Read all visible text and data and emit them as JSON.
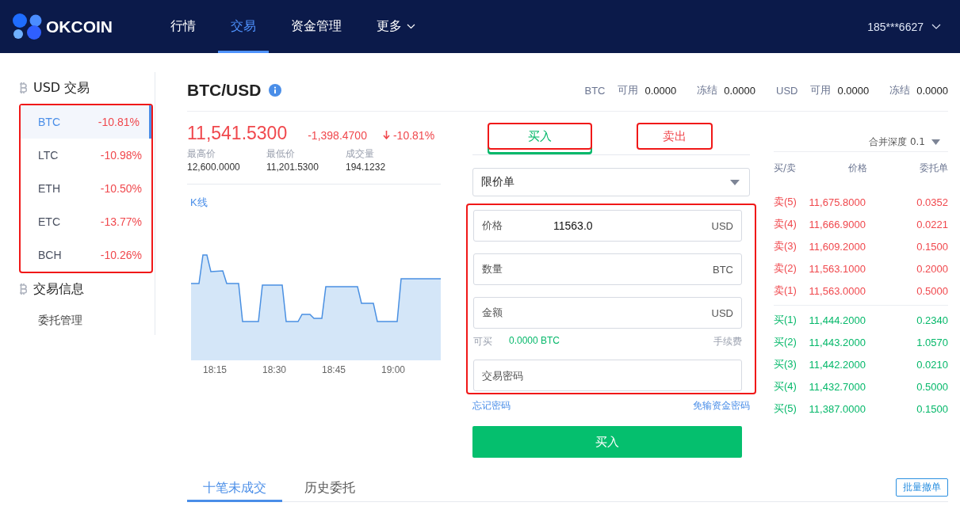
{
  "nav": {
    "logo": "OKCOIN",
    "items": [
      {
        "label": "行情",
        "selected": false,
        "dropdown": false
      },
      {
        "label": "交易",
        "selected": true,
        "dropdown": false
      },
      {
        "label": "资金管理",
        "selected": false,
        "dropdown": false
      },
      {
        "label": "更多",
        "selected": false,
        "dropdown": true
      }
    ],
    "user": "185***6627"
  },
  "sidebar": {
    "markets": {
      "title": "USD 交易",
      "items": [
        {
          "symbol": "BTC",
          "change": "-10.81%",
          "selected": true
        },
        {
          "symbol": "LTC",
          "change": "-10.98%",
          "selected": false
        },
        {
          "symbol": "ETH",
          "change": "-10.50%",
          "selected": false
        },
        {
          "symbol": "ETC",
          "change": "-13.77%",
          "selected": false
        },
        {
          "symbol": "BCH",
          "change": "-10.26%",
          "selected": false
        }
      ]
    },
    "info": {
      "title": "交易信息",
      "items": [
        "委托管理"
      ]
    }
  },
  "pair": {
    "title": "BTC/USD",
    "balances": [
      {
        "currency": "BTC",
        "available_label": "可用",
        "available": "0.0000",
        "frozen_label": "冻结",
        "frozen": "0.0000"
      },
      {
        "currency": "USD",
        "available_label": "可用",
        "available": "0.0000",
        "frozen_label": "冻结",
        "frozen": "0.0000"
      }
    ]
  },
  "ticker": {
    "last": "11,541.5300",
    "change": "-1,398.4700",
    "change_pct": "-10.81%",
    "falling": true,
    "stats": [
      {
        "label": "最高价",
        "value": "12,600.0000"
      },
      {
        "label": "最低价",
        "value": "11,201.5300"
      },
      {
        "label": "成交量",
        "value": "194.1232"
      }
    ]
  },
  "chart": {
    "tab": "K线",
    "xlabels": [
      "18:15",
      "18:30",
      "18:45",
      "19:00"
    ]
  },
  "order_form": {
    "tabs": [
      {
        "label": "买入",
        "selected": true
      },
      {
        "label": "卖出",
        "selected": false
      }
    ],
    "order_type": "限价单",
    "fields": [
      {
        "label": "价格",
        "value": "11563.0",
        "unit": "USD"
      },
      {
        "label": "数量",
        "unit": "BTC"
      },
      {
        "label": "金额",
        "unit": "USD"
      }
    ],
    "available_label": "可买",
    "available": "0.0000 BTC",
    "fee_label": "手续费",
    "password_placeholder": "交易密码",
    "forgot_link": "忘记密码",
    "no_password_link": "免输资金密码",
    "submit": "买入"
  },
  "order_book": {
    "depth": "合并深度 0.1",
    "columns": [
      "买/卖",
      "价格",
      "委托单"
    ],
    "asks": [
      {
        "side": "卖(5)",
        "price": "11,675.8000",
        "amount": "0.0352"
      },
      {
        "side": "卖(4)",
        "price": "11,666.9000",
        "amount": "0.0221"
      },
      {
        "side": "卖(3)",
        "price": "11,609.2000",
        "amount": "0.1500"
      },
      {
        "side": "卖(2)",
        "price": "11,563.1000",
        "amount": "0.2000"
      },
      {
        "side": "卖(1)",
        "price": "11,563.0000",
        "amount": "0.5000"
      }
    ],
    "bids": [
      {
        "side": "买(1)",
        "price": "11,444.2000",
        "amount": "0.2340"
      },
      {
        "side": "买(2)",
        "price": "11,443.2000",
        "amount": "1.0570"
      },
      {
        "side": "买(3)",
        "price": "11,442.2000",
        "amount": "0.0210"
      },
      {
        "side": "买(4)",
        "price": "11,432.7000",
        "amount": "0.5000"
      },
      {
        "side": "买(5)",
        "price": "11,387.0000",
        "amount": "0.1500"
      }
    ]
  },
  "orders": {
    "tabs": [
      {
        "label": "十笔未成交",
        "selected": true
      },
      {
        "label": "历史委托",
        "selected": false
      }
    ],
    "cancel_all": "批量撤单"
  }
}
